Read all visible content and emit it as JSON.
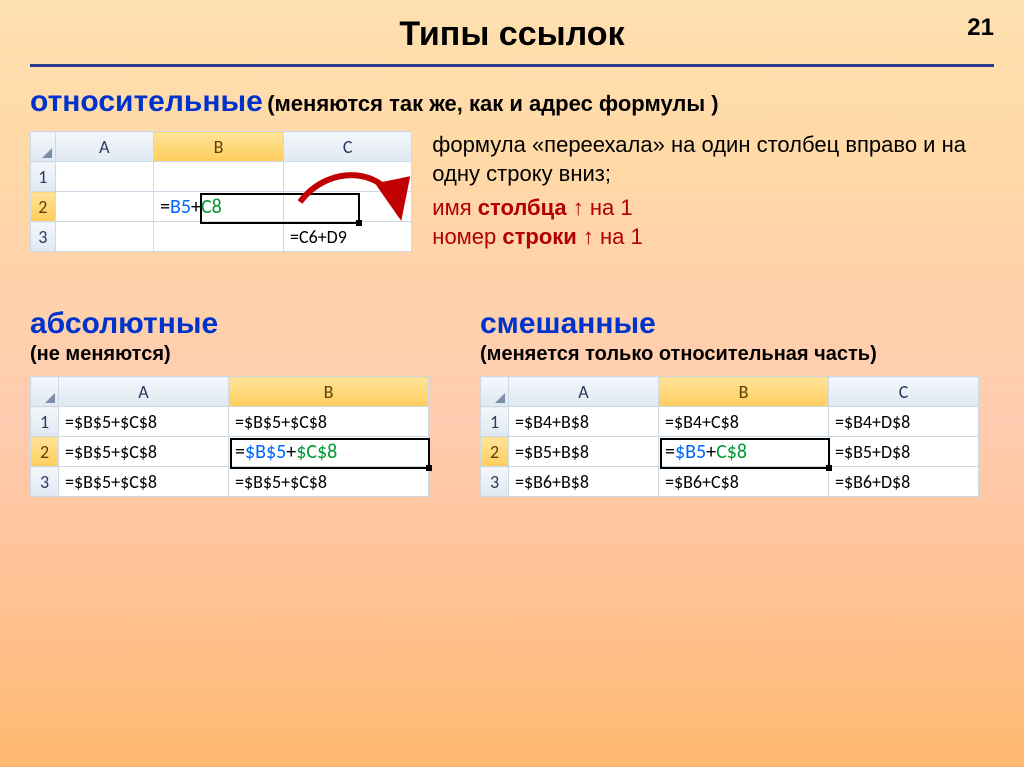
{
  "pageNumber": "21",
  "title": "Типы ссылок",
  "section1": {
    "heading": "относительные",
    "note": "(меняются так же, как и адрес формулы )",
    "explain_l1": "формула «переехала» на один столбец вправо и на одну строку вниз;",
    "explain_l2_pre": "имя ",
    "explain_l2_b1": "столбца",
    "explain_l2_mid": " ↑ на 1",
    "explain_l3_pre": "номер ",
    "explain_l3_b1": "строки",
    "explain_l3_mid": " ↑ на 1"
  },
  "grid1": {
    "cols": [
      "A",
      "B",
      "C"
    ],
    "rows": [
      "1",
      "2",
      "3"
    ],
    "B2_eq": "=",
    "B2_a": "B5",
    "B2_plus": "+",
    "B2_b": "C8",
    "C3": "=C6+D9"
  },
  "section2": {
    "heading": "абсолютные",
    "note": "(не меняются)"
  },
  "grid2": {
    "cols": [
      "A",
      "B"
    ],
    "rows": [
      "1",
      "2",
      "3"
    ],
    "cells": {
      "A1": "=$B$5+$C$8",
      "B1": "=$B$5+$C$8",
      "A2": "=$B$5+$C$8",
      "B2_eq": "=",
      "B2_a": "$B$5",
      "B2_plus": "+",
      "B2_b": "$C$8",
      "A3": "=$B$5+$C$8",
      "B3": "=$B$5+$C$8"
    }
  },
  "section3": {
    "heading": "смешанные",
    "note": "(меняется только относительная часть)"
  },
  "grid3": {
    "cols": [
      "A",
      "B",
      "C"
    ],
    "rows": [
      "1",
      "2",
      "3"
    ],
    "cells": {
      "A1": "=$B4+B$8",
      "B1": "=$B4+C$8",
      "C1": "=$B4+D$8",
      "A2": "=$B5+B$8",
      "B2_eq": "=",
      "B2_a": "$B5",
      "B2_plus": "+",
      "B2_b": "C$8",
      "C2": "=$B5+D$8",
      "A3": "=$B6+B$8",
      "B3": "=$B6+C$8",
      "C3": "=$B6+D$8"
    }
  }
}
